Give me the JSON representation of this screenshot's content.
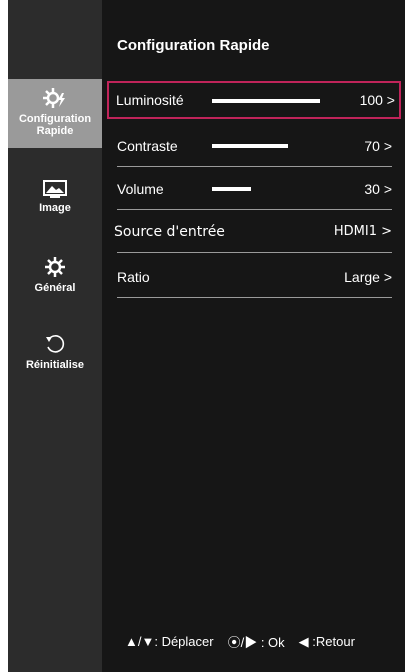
{
  "header": {
    "title": "Configuration Rapide"
  },
  "sidebar": {
    "items": [
      {
        "label_line1": "Configuration",
        "label_line2": "Rapide",
        "icon": "gear-lightning-icon",
        "active": true
      },
      {
        "label_line1": "Image",
        "icon": "picture-icon",
        "active": false
      },
      {
        "label_line1": "Général",
        "icon": "gear-icon",
        "active": false
      },
      {
        "label_line1": "Réinitialise",
        "icon": "reset-icon",
        "active": false
      }
    ]
  },
  "menu": {
    "rows": [
      {
        "label": "Luminosité",
        "value": "100 >",
        "level": 100
      },
      {
        "label": "Contraste",
        "value": "70 >",
        "level": 70
      },
      {
        "label": "Volume",
        "value": "30 >",
        "level": 30
      },
      {
        "label": "Source d'entrée",
        "value": "HDMI1 >"
      },
      {
        "label": "Ratio",
        "value": "Large >"
      }
    ]
  },
  "footer": {
    "move_label": "▲/▼: Déplacer",
    "ok_label": "⦿/▶ : Ok",
    "back_label": "◀ :Retour"
  },
  "colors": {
    "selection_border": "#c0245a",
    "sidebar_bg": "#2c2c2c",
    "active_item_bg": "#9a9a9a",
    "panel_bg": "#161616"
  }
}
